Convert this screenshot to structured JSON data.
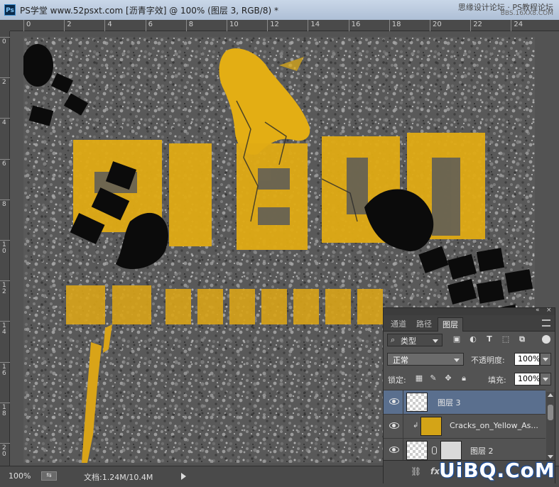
{
  "window": {
    "title": "PS学堂 www.52psxt.com [沥青字效] @ 100% (图层 3, RGB/8) *",
    "app_icon": "Ps",
    "watermark_line1": "思缘设计论坛 · PS教程论坛",
    "watermark_line2": "BBS.16XX8.COM"
  },
  "rulers": {
    "horizontal_labels": [
      "0",
      "2",
      "4",
      "6",
      "8",
      "10",
      "12",
      "14",
      "16",
      "18",
      "20",
      "22",
      "24"
    ],
    "vertical_labels": [
      "0",
      "2",
      "4",
      "6",
      "8",
      "10",
      "12",
      "14",
      "16",
      "18",
      "20"
    ]
  },
  "canvas": {
    "main_text": "PSXT",
    "secondary_text": "学习PHOTOSHOP",
    "colors": {
      "asphalt": "#5a5a5a",
      "paint": "#e8b312",
      "boot": "#0b0b0b"
    }
  },
  "status": {
    "zoom": "100%",
    "doc_info": "文档:1.24M/10.4M"
  },
  "layers_panel": {
    "tabs": [
      {
        "label": "通道"
      },
      {
        "label": "路径"
      },
      {
        "label": "图层"
      }
    ],
    "filter_kind": "类型",
    "filter_icons": [
      "image-filter-icon",
      "adjustment-filter-icon",
      "type-filter-icon",
      "shape-filter-icon",
      "smartobject-filter-icon"
    ],
    "blend_mode": "正常",
    "opacity_label": "不透明度:",
    "opacity_value": "100%",
    "lock_label": "锁定:",
    "fill_label": "填充:",
    "fill_value": "100%",
    "layers": [
      {
        "name": "图层 3",
        "selected": true
      },
      {
        "name": "Cracks_on_Yellow_As...",
        "selected": false
      },
      {
        "name": "图层 2",
        "selected": false
      }
    ],
    "bottom_icons": [
      "link-icon",
      "fx-icon"
    ]
  },
  "branding": {
    "text": "UiBQ.CoM"
  }
}
